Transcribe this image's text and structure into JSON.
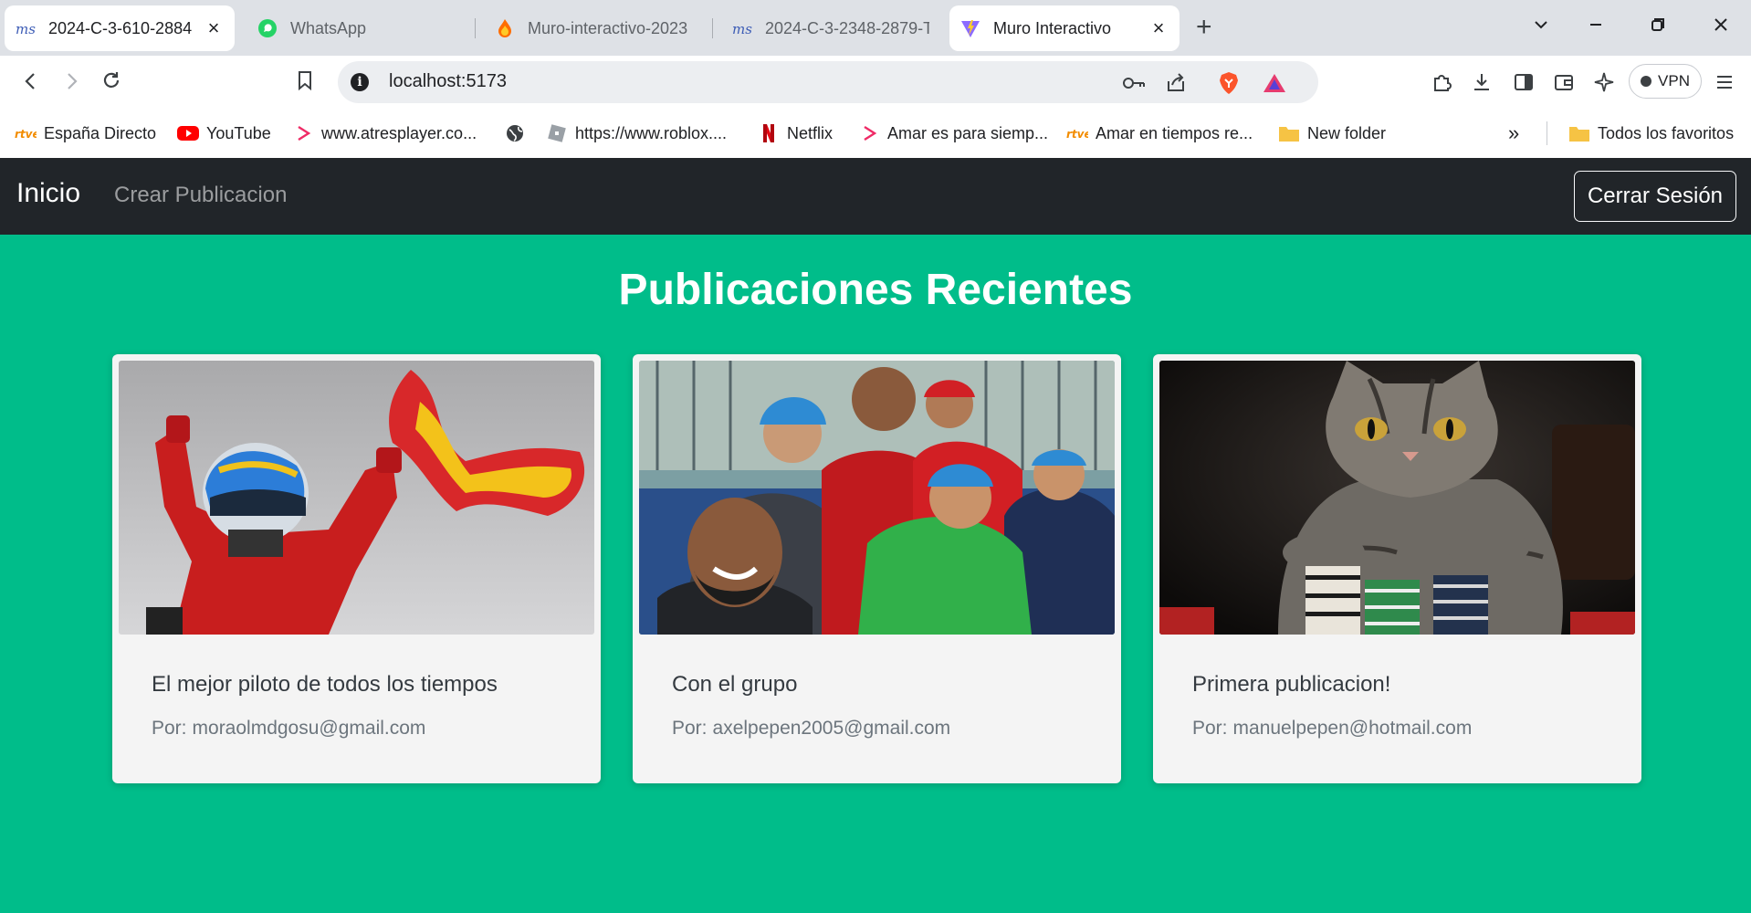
{
  "browser": {
    "tabs": [
      {
        "title": "2024-C-3-610-2884",
        "favicon": "ms-icon",
        "active": false
      },
      {
        "title": "WhatsApp",
        "favicon": "whatsapp-icon",
        "active": false
      },
      {
        "title": "Muro-interactivo-2023",
        "favicon": "firebase-icon",
        "active": false
      },
      {
        "title": "2024-C-3-2348-2879-T",
        "favicon": "ms-icon",
        "active": false
      },
      {
        "title": "Muro Interactivo",
        "favicon": "vite-icon",
        "active": true
      }
    ],
    "url": "localhost:5173",
    "vpn_label": "VPN",
    "bookmarks": [
      {
        "label": "España Directo",
        "icon": "rtve-icon"
      },
      {
        "label": "YouTube",
        "icon": "youtube-icon"
      },
      {
        "label": "www.atresplayer.co...",
        "icon": "atresplayer-icon"
      },
      {
        "label": "",
        "icon": "globe-icon"
      },
      {
        "label": "https://www.roblox....",
        "icon": "roblox-icon"
      },
      {
        "label": "Netflix",
        "icon": "netflix-icon"
      },
      {
        "label": "Amar es para siemp...",
        "icon": "atresplayer-icon"
      },
      {
        "label": "Amar en tiempos re...",
        "icon": "rtve-icon"
      },
      {
        "label": "New folder",
        "icon": "folder-icon"
      }
    ],
    "bookmarks_overflow": "»",
    "all_bookmarks_label": "Todos los favoritos"
  },
  "app": {
    "brand": "Inicio",
    "nav_link": "Crear Publicacion",
    "logout_label": "Cerrar Sesión",
    "page_title": "Publicaciones Recientes",
    "author_prefix": "Por:",
    "posts": [
      {
        "title": "El mejor piloto de todos los tiempos",
        "author": "moraolmdgosu@gmail.com",
        "image": "racing-driver-with-flag"
      },
      {
        "title": "Con el grupo",
        "author": "axelpepen2005@gmail.com",
        "image": "group-selfie"
      },
      {
        "title": "Primera publicacion!",
        "author": "manuelpepen@hotmail.com",
        "image": "cat-with-poker-chips"
      }
    ]
  },
  "colors": {
    "background": "#00bd8a",
    "navbar": "#212529",
    "card": "#f4f4f4"
  }
}
